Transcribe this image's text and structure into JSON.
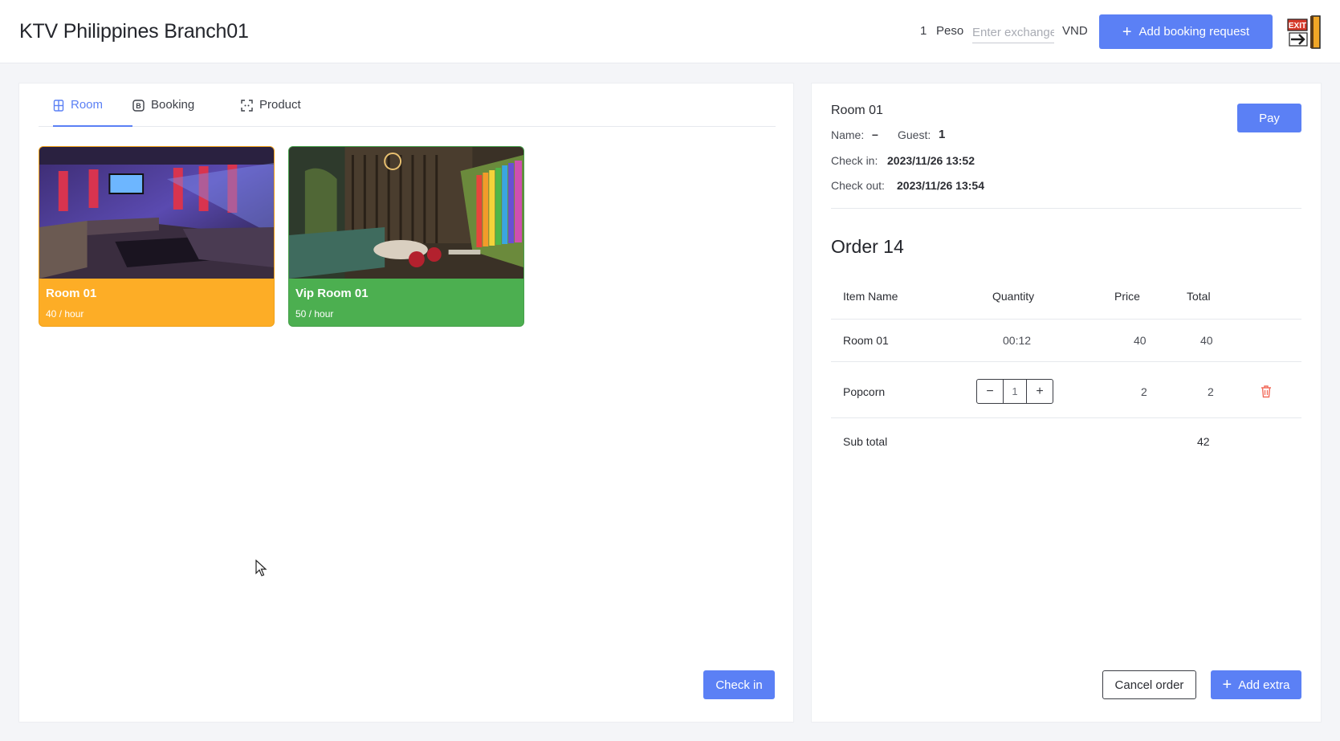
{
  "header": {
    "title": "KTV Philippines Branch01",
    "rate_amount": "1",
    "rate_currency_from": "Peso",
    "rate_placeholder": "Enter exchange",
    "rate_currency_to": "VND",
    "add_booking_label": "Add booking request",
    "exit_icon": "exit-sign-icon"
  },
  "tabs": [
    {
      "label": "Room",
      "icon": "room-icon",
      "active": true
    },
    {
      "label": "Booking",
      "icon": "booking-icon",
      "active": false
    },
    {
      "label": "Product",
      "icon": "product-icon",
      "active": false
    }
  ],
  "rooms": [
    {
      "name": "Room 01",
      "rate": "40 / hour",
      "color": "#fdad26"
    },
    {
      "name": "Vip Room 01",
      "rate": "50 / hour",
      "color": "#4caf50"
    }
  ],
  "checkin_label": "Check in",
  "detail": {
    "room": "Room 01",
    "name_label": "Name:",
    "name_value": "–",
    "guest_label": "Guest:",
    "guest_value": "1",
    "checkin_label": "Check in:",
    "checkin_value": "2023/11/26 13:52",
    "checkout_label": "Check out:",
    "checkout_value": "2023/11/26 13:54",
    "pay_label": "Pay"
  },
  "order": {
    "title": "Order 14",
    "columns": [
      "Item Name",
      "Quantity",
      "Price",
      "Total"
    ],
    "rows": [
      {
        "name": "Room 01",
        "quantity": "00:12",
        "price": "40",
        "total": "40"
      },
      {
        "name": "Popcorn",
        "quantity": "1",
        "price": "2",
        "total": "2"
      }
    ],
    "subtotal_label": "Sub total",
    "subtotal_value": "42",
    "cancel_label": "Cancel order",
    "add_extra_label": "Add extra"
  },
  "colors": {
    "accent": "#5b80f5",
    "room_available": "#fdad26",
    "vip_room": "#4caf50",
    "delete": "#f26b5b"
  }
}
